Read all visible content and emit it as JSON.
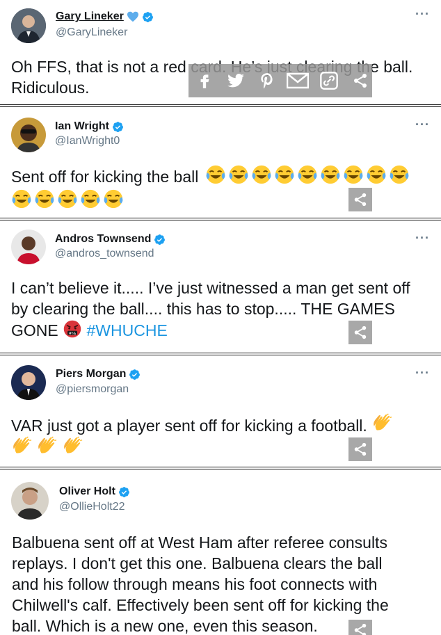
{
  "tweets": [
    {
      "name": "Gary Lineker",
      "handle": "@GaryLineker",
      "line1": "Oh FFS, that is not a red card. He’s just clearing the ball.",
      "line2": "Ridiculous."
    },
    {
      "name": "Ian Wright",
      "handle": "@IanWright0",
      "text": "Sent off for kicking the ball"
    },
    {
      "name": "Andros Townsend",
      "handle": "@andros_townsend",
      "line1": "I can’t believe it..... I’ve just witnessed a man get sent off",
      "line2": "by clearing the ball.... this has to stop..... THE GAMES",
      "line3": "GONE",
      "hashtag": "#WHUCHE"
    },
    {
      "name": "Piers Morgan",
      "handle": "@piersmorgan",
      "text": "VAR just got a player sent off for kicking a football."
    },
    {
      "name": "Oliver Holt",
      "handle": "@OllieHolt22",
      "line1": "Balbuena sent off at West Ham after referee consults",
      "line2": "replays. I don't get this one. Balbuena clears the ball",
      "line3": "and his follow through means his foot connects with",
      "line4": "Chilwell's calf. Effectively been sent off for kicking the",
      "line5": "ball. Which is a new one, even this season."
    }
  ],
  "more_label": "···",
  "share_bar": {
    "icons": [
      "facebook-icon",
      "twitter-icon",
      "pinterest-icon",
      "email-icon",
      "link-icon",
      "share-icon"
    ]
  },
  "colors": {
    "verified": "#1da1f2",
    "hashtag": "#1b95e0",
    "handle": "#657786",
    "share_button": "#a8a8a8"
  }
}
